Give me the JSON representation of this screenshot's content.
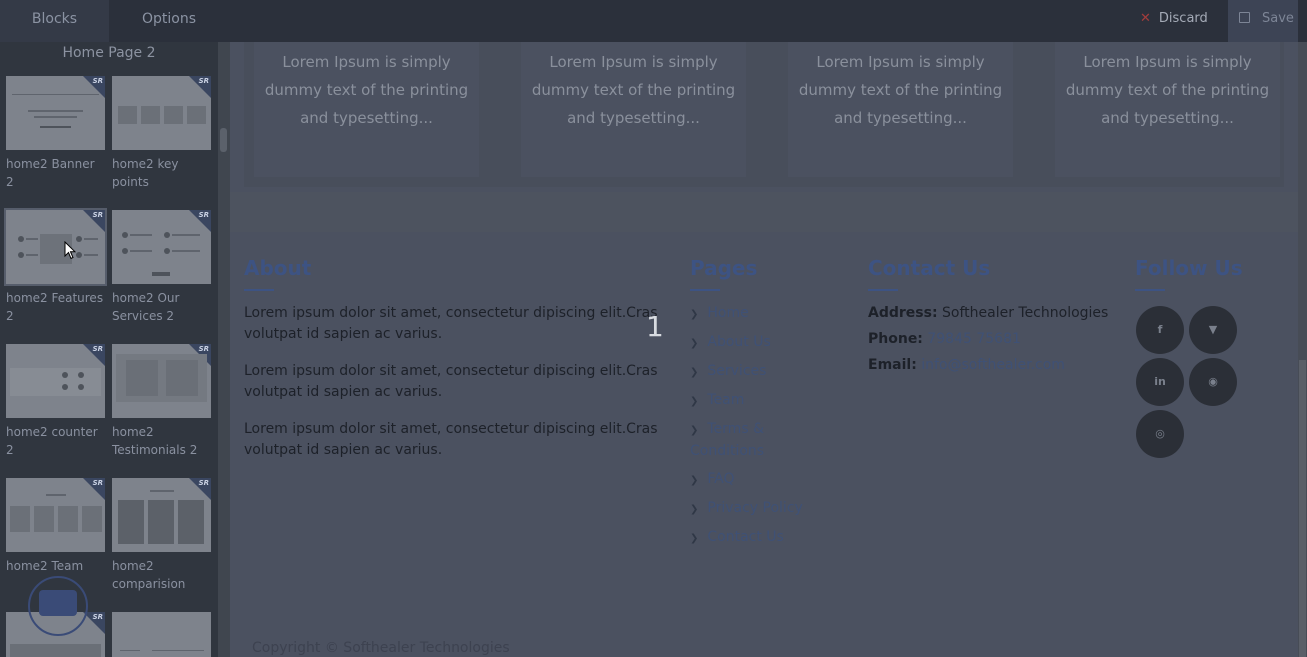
{
  "topbar": {
    "tabs": [
      "Blocks",
      "Options"
    ],
    "discard_label": "Discard",
    "save_label": "Save"
  },
  "sidebar": {
    "title": "Home Page 2",
    "blocks": [
      {
        "label": "home2 Banner 2"
      },
      {
        "label": "home2 key points"
      },
      {
        "label": "home2 Features 2"
      },
      {
        "label": "home2 Our Services 2"
      },
      {
        "label": "home2 counter 2"
      },
      {
        "label": "home2 Testimonials 2"
      },
      {
        "label": "home2 Team"
      },
      {
        "label": "home2 comparision"
      }
    ],
    "badge": "SR"
  },
  "cards": [
    {
      "text": "Lorem Ipsum is simply dummy text of the printing and typesetting..."
    },
    {
      "text": "Lorem Ipsum is simply dummy text of the printing and typesetting..."
    },
    {
      "text": "Lorem Ipsum is simply dummy text of the printing and typesetting..."
    },
    {
      "text": "Lorem Ipsum is simply dummy text of the printing and typesetting..."
    }
  ],
  "footer": {
    "about": {
      "heading": "About",
      "paragraphs": [
        "Lorem ipsum dolor sit amet, consectetur dipiscing elit.Cras volutpat id sapien ac varius.",
        "Lorem ipsum dolor sit amet, consectetur dipiscing elit.Cras volutpat id sapien ac varius.",
        "Lorem ipsum dolor sit amet, consectetur dipiscing elit.Cras volutpat id sapien ac varius."
      ]
    },
    "pages": {
      "heading": "Pages",
      "links": [
        "Home",
        "About Us",
        "Services",
        "Team",
        "Terms & Conditions",
        "FAQ",
        "Privacy Policy",
        "Contact Us"
      ]
    },
    "contact": {
      "heading": "Contact Us",
      "address_label": "Address:",
      "address": "Softhealer Technologies",
      "phone_label": "Phone:",
      "phone": "79845 75681",
      "email_label": "Email:",
      "email": "info@softhealer.com"
    },
    "follow": {
      "heading": "Follow Us",
      "icons": [
        "facebook-icon",
        "twitter-icon",
        "linkedin-icon",
        "github-icon",
        "instagram-icon"
      ]
    },
    "overlay_number": "1",
    "copyright": "Copyright © Softhealer Technologies"
  }
}
